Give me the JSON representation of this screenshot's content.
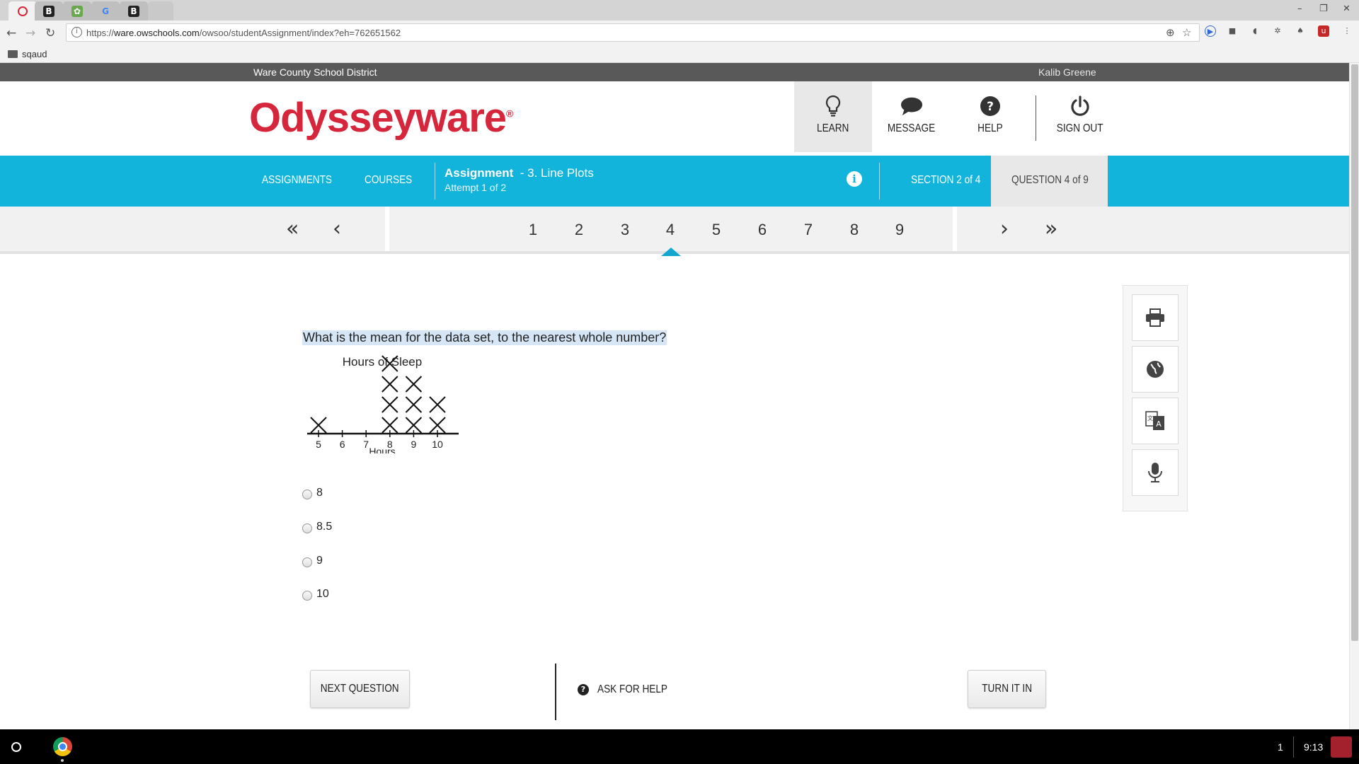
{
  "browser": {
    "tabs": [
      {
        "icon": "odysseyware-favicon",
        "active": true
      },
      {
        "icon": "b-favicon",
        "glyph": "B"
      },
      {
        "icon": "green-favicon",
        "glyph": "✿"
      },
      {
        "icon": "google-favicon",
        "glyph": "G"
      },
      {
        "icon": "b-favicon",
        "glyph": "B"
      }
    ],
    "url_prefix": "https://",
    "url_host": "ware.owschools.com",
    "url_path": "/owsoo/studentAssignment/index?eh=762651562",
    "bookmark": "sqaud"
  },
  "site": {
    "district": "Ware County School District",
    "user": "Kalib Greene",
    "logo": "Odysseyware",
    "logo_mark": "®",
    "brand_color": "#d6263b",
    "accent_color": "#13b4dc",
    "header_nav": [
      {
        "label": "LEARN",
        "icon": "lightbulb-icon"
      },
      {
        "label": "MESSAGE",
        "icon": "speech-bubble-icon"
      },
      {
        "label": "HELP",
        "icon": "question-circle-icon"
      },
      {
        "label": "SIGN OUT",
        "icon": "power-icon"
      }
    ]
  },
  "bluebar": {
    "assignments": "ASSIGNMENTS",
    "courses": "COURSES",
    "assignment_label": "Assignment",
    "assignment_name": "- 3. Line Plots",
    "attempt": "Attempt 1 of 2",
    "section": "SECTION 2 of 4",
    "question": "QUESTION 4 of 9"
  },
  "qnav": {
    "numbers": [
      "1",
      "2",
      "3",
      "4",
      "5",
      "6",
      "7",
      "8",
      "9"
    ],
    "current": 4
  },
  "question": {
    "text": "What is the mean for the data set, to the nearest whole number?",
    "options": [
      "8",
      "8.5",
      "9",
      "10"
    ]
  },
  "chart_data": {
    "type": "scatter",
    "title": "Hours of Sleep",
    "xlabel": "Hours",
    "categories": [
      "5",
      "6",
      "7",
      "8",
      "9",
      "10"
    ],
    "counts": [
      1,
      0,
      0,
      4,
      3,
      2
    ]
  },
  "tools": [
    {
      "icon": "print-icon"
    },
    {
      "icon": "globe-icon"
    },
    {
      "icon": "translate-icon"
    },
    {
      "icon": "microphone-icon"
    }
  ],
  "footer": {
    "next": "NEXT QUESTION",
    "ask_help": "ASK FOR HELP",
    "turn_in": "TURN IT IN"
  },
  "taskbar": {
    "count": "1",
    "time": "9:13"
  }
}
